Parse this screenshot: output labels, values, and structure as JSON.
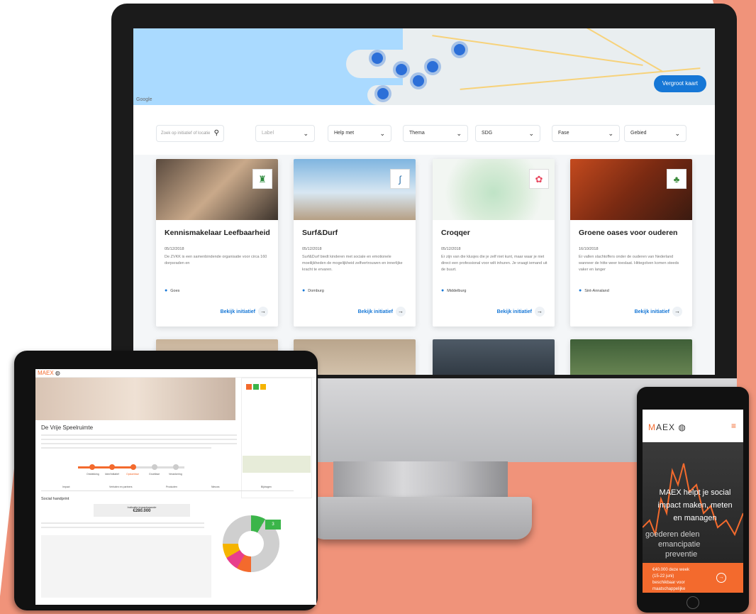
{
  "desktop": {
    "map": {
      "button_label": "Vergroot kaart",
      "google_label": "Google"
    },
    "filters": {
      "search_placeholder": "Zoek op initiatief of locatie",
      "dropdowns": [
        {
          "label": "Label"
        },
        {
          "label": "Help met"
        },
        {
          "label": "Thema"
        },
        {
          "label": "SDG"
        },
        {
          "label": "Fase"
        },
        {
          "label": "Gebied"
        }
      ]
    },
    "cards": [
      {
        "title": "Kennismakelaar Leefbaarheid",
        "date": "05/12/2018",
        "description": "De ZVKK is een samenbindende organisatie voor circa 160 dorpsraden en",
        "location": "Goes",
        "link": "Bekijk initiatief"
      },
      {
        "title": "Surf&Durf",
        "date": "05/12/2018",
        "description": "Surf&Durf biedt kinderen met sociale en emotionele moeilijkheden de mogelijkheid zelfvertrouwen en innerlijke kracht te ervaren.",
        "location": "Domburg",
        "link": "Bekijk initiatief"
      },
      {
        "title": "Croqqer",
        "date": "05/12/2018",
        "description": "Er zijn van die klusjes die je zelf niet kunt, maar waar je niet direct een professional voor wilt inhuren. Je vraagt iemand uit de buurt.",
        "location": "Middelburg",
        "link": "Bekijk initiatief"
      },
      {
        "title": "Groene oases voor ouderen",
        "date": "16/10/2018",
        "description": "Er vallen slachtoffers onder de ouderen van Nederland wanneer de hitte weer toeslaat. Hittegolven komen steeds vaker en langer",
        "location": "Sint-Annaland",
        "link": "Bekijk initiatief"
      }
    ]
  },
  "tablet": {
    "brand": "MAEX",
    "page_title": "De Vrije Speelruimte",
    "steps": [
      "Ontdekking",
      "Idee/Initiatief",
      "Opstartfase",
      "Groeifase",
      "Verankering"
    ],
    "tabs": [
      "Impact",
      "Verhalen en partners",
      "Producten",
      "Nieuws",
      "Bijdragen"
    ],
    "social_handprint_title": "Social handprint",
    "value_label": "Indicatie impactwaarde",
    "value_amount": "€280.000",
    "donut_label": "3"
  },
  "phone": {
    "brand_m": "M",
    "brand_rest": "AEX",
    "tagline": "MAEX helpt je social impact maken, meten en managen",
    "ticker": [
      "goederen delen",
      "emancipatie",
      "preventie"
    ],
    "cta_line1": "€40.000 deze week",
    "cta_line2": "(15-22 juni)",
    "cta_line3": "beschikbaar voor",
    "cta_line4": "maatschappelijke"
  },
  "colors": {
    "brand_orange": "#f36a2d",
    "link_blue": "#1677d6",
    "backdrop": "#f0937a"
  },
  "icons": [
    "search-icon",
    "chevron-down-icon",
    "location-pin-icon",
    "arrow-right-icon",
    "hamburger-menu-icon",
    "globe-icon"
  ]
}
